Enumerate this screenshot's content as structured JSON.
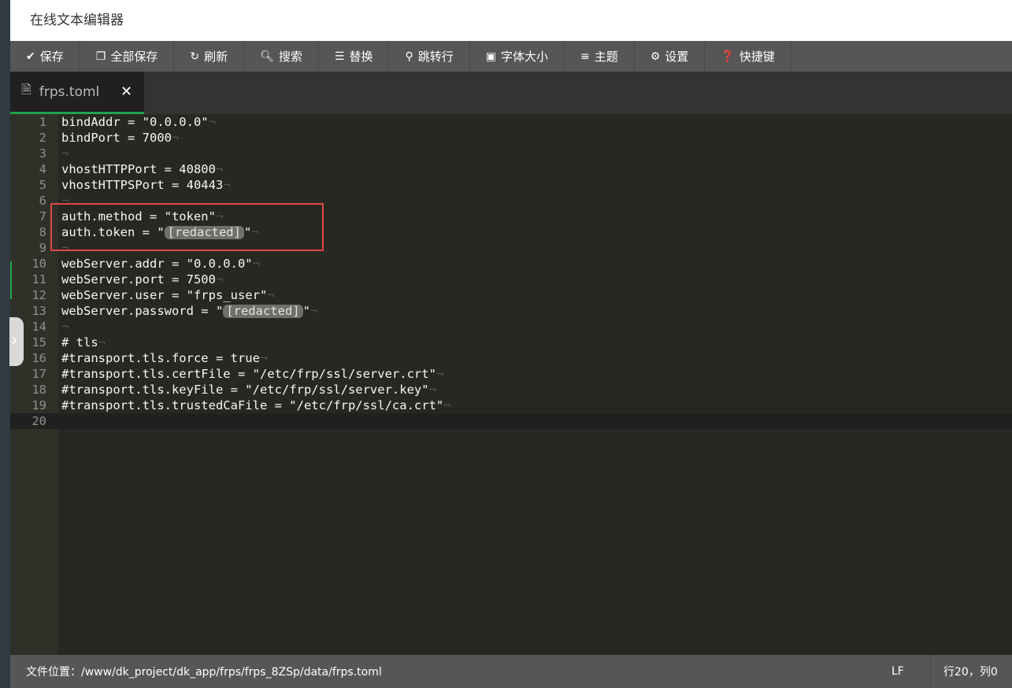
{
  "window": {
    "title": "在线文本编辑器"
  },
  "toolbar": [
    {
      "icon": "check-icon",
      "glyph": "✔",
      "label": "保存"
    },
    {
      "icon": "copy-icon",
      "glyph": "❐",
      "label": "全部保存"
    },
    {
      "icon": "refresh-icon",
      "glyph": "↻",
      "label": "刷新"
    },
    {
      "icon": "search-icon",
      "glyph": "🔍︎",
      "label": "搜索"
    },
    {
      "icon": "replace-icon",
      "glyph": "☰",
      "label": "替换"
    },
    {
      "icon": "location-icon",
      "glyph": "⚲",
      "label": "跳转行"
    },
    {
      "icon": "font-size-icon",
      "glyph": "▣",
      "label": "字体大小"
    },
    {
      "icon": "menu-icon",
      "glyph": "≡",
      "label": "主题"
    },
    {
      "icon": "gear-icon",
      "glyph": "⚙",
      "label": "设置"
    },
    {
      "icon": "help-icon",
      "glyph": "❓",
      "label": "快捷键"
    }
  ],
  "tab": {
    "name": "frps.toml",
    "close": "✕"
  },
  "lines": [
    "bindAddr = \"0.0.0.0\"",
    "bindPort = 7000",
    "",
    "vhostHTTPPort = 40800",
    "vhostHTTPSPort = 40443",
    "",
    "auth.method = \"token\"",
    "auth.token = \"[redacted]\"",
    "",
    "webServer.addr = \"0.0.0.0\"",
    "webServer.port = 7500",
    "webServer.user = \"frps_user\"",
    "webServer.password = \"[redacted]\"",
    "",
    "# tls",
    "#transport.tls.force = true",
    "#transport.tls.certFile = \"/etc/frp/ssl/server.crt\"",
    "#transport.tls.keyFile = \"/etc/frp/ssl/server.key\"",
    "#transport.tls.trustedCaFile = \"/etc/frp/ssl/ca.crt\"",
    ""
  ],
  "cursor_line": 20,
  "status": {
    "path": "文件位置：/www/dk_project/dk_app/frps/frps_8ZSp/data/frps.toml",
    "eol": "LF",
    "position": "行20，列0"
  }
}
